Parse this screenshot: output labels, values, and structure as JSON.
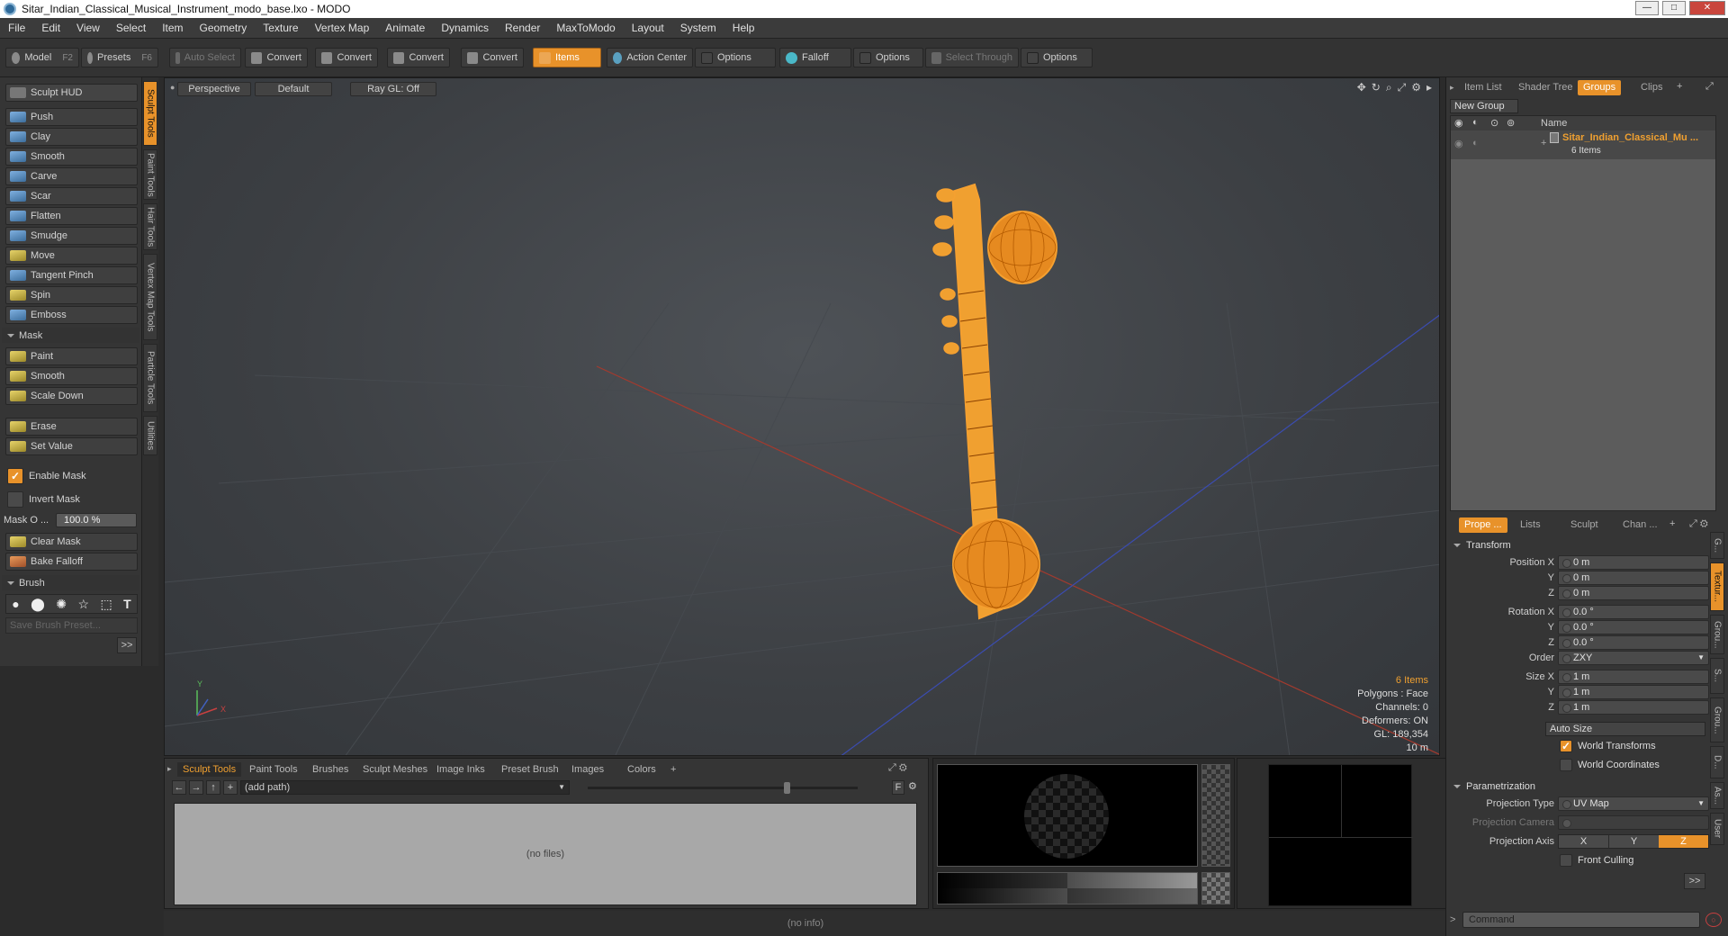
{
  "window": {
    "title": "Sitar_Indian_Classical_Musical_Instrument_modo_base.lxo - MODO"
  },
  "menu": [
    "File",
    "Edit",
    "View",
    "Select",
    "Item",
    "Geometry",
    "Texture",
    "Vertex Map",
    "Animate",
    "Dynamics",
    "Render",
    "MaxToModo",
    "Layout",
    "System",
    "Help"
  ],
  "toolbar": {
    "model": "Model",
    "model_key": "F2",
    "presets": "Presets",
    "presets_key": "F6",
    "auto_select": "Auto Select",
    "convert1": "Convert",
    "convert2": "Convert",
    "convert3": "Convert",
    "convert4": "Convert",
    "items": "Items",
    "action_center": "Action Center",
    "options1": "Options",
    "falloff": "Falloff",
    "options2": "Options",
    "select_through": "Select Through",
    "options3": "Options"
  },
  "left": {
    "sculpt_hud": "Sculpt HUD",
    "tools": [
      "Push",
      "Clay",
      "Smooth",
      "Carve",
      "Scar",
      "Flatten",
      "Smudge",
      "Move",
      "Tangent Pinch",
      "Spin",
      "Emboss"
    ],
    "mask_section": "Mask",
    "mask_tools": [
      "Paint",
      "Smooth",
      "Scale Down"
    ],
    "erase": "Erase",
    "set_value": "Set Value",
    "enable_mask": "Enable Mask",
    "invert_mask": "Invert Mask",
    "mask_opacity_label": "Mask O ...",
    "mask_opacity_value": "100.0 %",
    "clear_mask": "Clear Mask",
    "bake_falloff": "Bake Falloff",
    "brush_section": "Brush",
    "save_brush_preset": "Save Brush Preset...",
    "more": ">>"
  },
  "vtabs": [
    "Sculpt Tools",
    "Paint Tools",
    "Hair Tools",
    "Vertex Map Tools",
    "Particle Tools",
    "Utilities"
  ],
  "viewport": {
    "view": "Perspective",
    "shading": "Default",
    "raygl": "Ray GL: Off",
    "info": {
      "items": "6 Items",
      "polygons": "Polygons : Face",
      "channels": "Channels: 0",
      "deformers": "Deformers: ON",
      "gl": "GL: 189,354",
      "scale": "10 m"
    },
    "axis": {
      "y": "Y",
      "x": "X"
    }
  },
  "bottom": {
    "tabs": [
      "Sculpt Tools",
      "Paint Tools",
      "Brushes",
      "Sculpt Meshes",
      "Image Inks",
      "Preset Brush",
      "Images",
      "Colors"
    ],
    "path": "(add path)",
    "f_label": "F",
    "no_files": "(no files)"
  },
  "status": {
    "text": "(no info)"
  },
  "right": {
    "top_tabs": [
      "Item List",
      "Shader Tree",
      "Groups",
      "Clips"
    ],
    "new_group": "New Group",
    "name_header": "Name",
    "group_name": "Sitar_Indian_Classical_Mu ...",
    "group_count": "6 Items",
    "prop_tabs": [
      "Prope ...",
      "Lists",
      "Sculpt",
      "Chan ..."
    ],
    "transform": "Transform",
    "position_label": "Position X",
    "pos": [
      "0 m",
      "0 m",
      "0 m"
    ],
    "rotation_label": "Rotation X",
    "rot": [
      "0.0 °",
      "0.0 °",
      "0.0 °"
    ],
    "y": "Y",
    "z": "Z",
    "order_label": "Order",
    "order_value": "ZXY",
    "size_label": "Size X",
    "size": [
      "1 m",
      "1 m",
      "1 m"
    ],
    "auto_size": "Auto Size",
    "world_transforms": "World Transforms",
    "world_coordinates": "World Coordinates",
    "parametrization": "Parametrization",
    "projection_type_label": "Projection Type",
    "projection_type_value": "UV Map",
    "projection_camera_label": "Projection Camera",
    "projection_axis_label": "Projection Axis",
    "axis_x": "X",
    "axis_y": "Y",
    "axis_z": "Z",
    "front_culling": "Front Culling",
    "more": ">>",
    "command_placeholder": "Command",
    "side_tabs": [
      "G...",
      "Textur...",
      "Grou...",
      "S...",
      "Grou...",
      "D...",
      "As...",
      "User"
    ]
  },
  "colors": {
    "accent": "#e8922a",
    "mesh": "#f5a030"
  }
}
